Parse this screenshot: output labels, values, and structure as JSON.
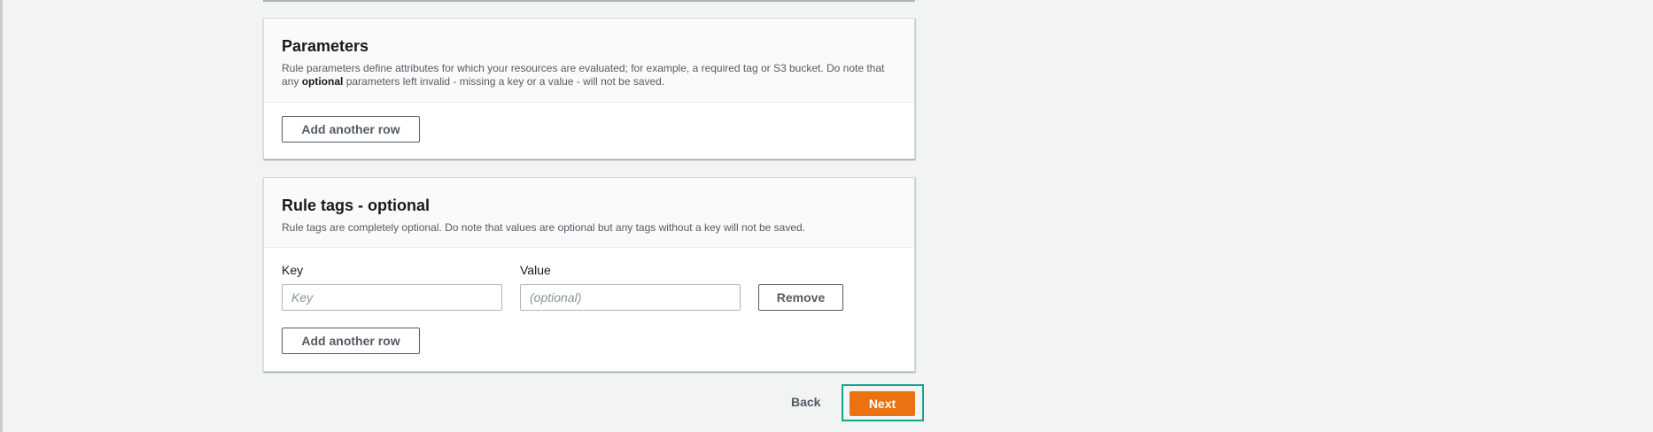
{
  "parameters": {
    "title": "Parameters",
    "description_line1": "Rule parameters define attributes for which your resources are evaluated; for example, a required tag or S3 bucket. Do note that",
    "description_pre": "any ",
    "description_bold": "optional",
    "description_post": " parameters left invalid - missing a key or a value - will not be saved.",
    "add_row_label": "Add another row"
  },
  "rule_tags": {
    "title": "Rule tags - optional",
    "description": "Rule tags are completely optional. Do note that values are optional but any tags without a key will not be saved.",
    "key_label": "Key",
    "key_placeholder": "Key",
    "key_value": "",
    "value_label": "Value",
    "value_placeholder": "(optional)",
    "value_value": "",
    "remove_label": "Remove",
    "add_row_label": "Add another row"
  },
  "footer": {
    "back_label": "Back",
    "next_label": "Next"
  },
  "colors": {
    "primary_button": "#ec7211",
    "highlight_outline": "#1aa38c"
  }
}
